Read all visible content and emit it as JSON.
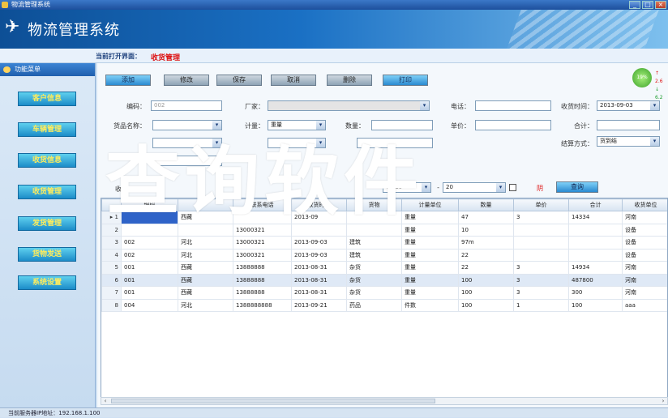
{
  "window": {
    "title": "物流管理系统"
  },
  "banner": {
    "title": "物流管理系统"
  },
  "crumb": {
    "label": "当前打开界面：",
    "value": "收货管理"
  },
  "sidebar": {
    "header": "功能菜单",
    "items": [
      {
        "label": "客户信息"
      },
      {
        "label": "车辆管理"
      },
      {
        "label": "收货信息"
      },
      {
        "label": "收货管理"
      },
      {
        "label": "发货管理"
      },
      {
        "label": "货物发送"
      },
      {
        "label": "系统设置"
      }
    ]
  },
  "toolbar": {
    "add": "添加",
    "edit": "修改",
    "save": "保存",
    "cancel": "取消",
    "delete": "删除",
    "print": "打印"
  },
  "gauge": {
    "percent": "19%",
    "up_value": "2.6",
    "down_value": "6.2"
  },
  "form": {
    "code_label": "编码：",
    "code_placeholder": "002",
    "vendor_label": "厂家：",
    "phone_label": "电话：",
    "recv_time_label": "收货时间：",
    "recv_time_value": "2013-09-03",
    "goods_name_label": "货品名称：",
    "measure_label": "计量：",
    "measure_value": "重量",
    "qty_label": "数量：",
    "unit_price_label": "单价：",
    "total_label": "合计：",
    "settle_label": "结算方式：",
    "settle_value": "货到结",
    "search_label": "收",
    "date_from": "09-23",
    "date_sep": "-",
    "date_to": "20",
    "red_text": "阴",
    "query_button": "查询"
  },
  "grid": {
    "columns": [
      "编码",
      "",
      "联系电话",
      "收货时间",
      "货物",
      "计量单位",
      "数量",
      "单价",
      "合计",
      "收货单位"
    ],
    "rows": [
      [
        "",
        "西藏",
        "",
        "2013-09",
        "",
        "重量",
        "47",
        "3",
        "14334",
        "河南"
      ],
      [
        "",
        "",
        "13000321",
        "",
        "",
        "重量",
        "10",
        "",
        "",
        "设备"
      ],
      [
        "002",
        "河北",
        "13000321",
        "2013-09-03",
        "建筑",
        "重量",
        "97m",
        "",
        "",
        "设备"
      ],
      [
        "002",
        "河北",
        "13000321",
        "2013-09-03",
        "建筑",
        "重量",
        "22",
        "",
        "",
        "设备"
      ],
      [
        "001",
        "西藏",
        "13888888",
        "2013-08-31",
        "杂货",
        "重量",
        "22",
        "3",
        "14934",
        "河南"
      ],
      [
        "001",
        "西藏",
        "13888888",
        "2013-08-31",
        "杂货",
        "重量",
        "100",
        "3",
        "487800",
        "河南"
      ],
      [
        "001",
        "西藏",
        "13888888",
        "2013-08-31",
        "杂货",
        "重量",
        "100",
        "3",
        "300",
        "河南"
      ],
      [
        "004",
        "河北",
        "1388888888",
        "2013-09-21",
        "药品",
        "件数",
        "100",
        "1",
        "100",
        "aaa"
      ]
    ]
  },
  "status": {
    "text": "当前服务器IP地址：192.168.1.100"
  },
  "watermark": {
    "text": "查询软件"
  }
}
